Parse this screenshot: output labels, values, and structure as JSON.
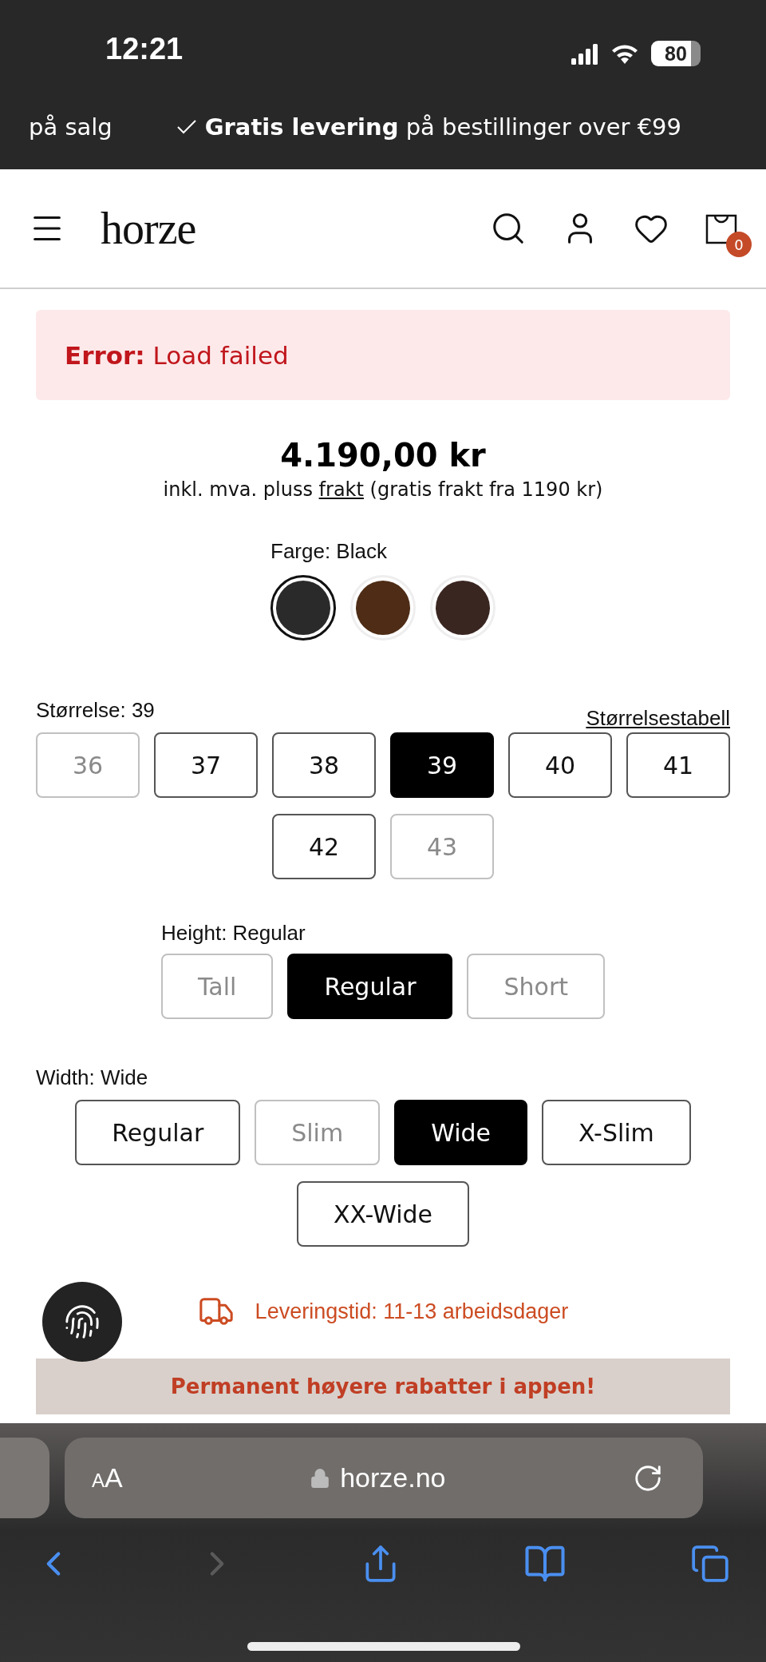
{
  "status_bar": {
    "time": "12:21",
    "battery": "80"
  },
  "promo_bar": {
    "left": "på salg",
    "bold": "Gratis levering",
    "rest": "på bestillinger over €99"
  },
  "header": {
    "logo": "horze",
    "cart_count": "0"
  },
  "error": {
    "label": "Error:",
    "message": "Load failed"
  },
  "price": {
    "amount": "4.190,00 kr",
    "note_before": "inkl. mva. pluss",
    "note_link": "frakt",
    "note_after": "(gratis frakt fra 1190 kr)"
  },
  "colors": {
    "label": "Farge: Black",
    "swatches": [
      {
        "color": "#2a2a2a",
        "selected": true
      },
      {
        "color": "#4e2c15",
        "selected": false
      },
      {
        "color": "#3a2621",
        "selected": false
      }
    ]
  },
  "sizes": {
    "label": "Størrelse: 39",
    "chart_link": "Størrelsestabell",
    "options": [
      {
        "label": "36",
        "selected": false,
        "disabled": true
      },
      {
        "label": "37",
        "selected": false,
        "disabled": false
      },
      {
        "label": "38",
        "selected": false,
        "disabled": false
      },
      {
        "label": "39",
        "selected": true,
        "disabled": false
      },
      {
        "label": "40",
        "selected": false,
        "disabled": false
      },
      {
        "label": "41",
        "selected": false,
        "disabled": false
      },
      {
        "label": "42",
        "selected": false,
        "disabled": false
      },
      {
        "label": "43",
        "selected": false,
        "disabled": true
      }
    ]
  },
  "height": {
    "label": "Height: Regular",
    "options": [
      {
        "label": "Tall",
        "selected": false,
        "disabled": true
      },
      {
        "label": "Regular",
        "selected": true,
        "disabled": false
      },
      {
        "label": "Short",
        "selected": false,
        "disabled": true
      }
    ]
  },
  "width": {
    "label": "Width: Wide",
    "options": [
      {
        "label": "Regular",
        "selected": false,
        "disabled": false
      },
      {
        "label": "Slim",
        "selected": false,
        "disabled": true
      },
      {
        "label": "Wide",
        "selected": true,
        "disabled": false
      },
      {
        "label": "X-Slim",
        "selected": false,
        "disabled": false
      },
      {
        "label": "XX-Wide",
        "selected": false,
        "disabled": false
      }
    ]
  },
  "delivery": {
    "text": "Leveringstid: 11-13 arbeidsdager"
  },
  "app_banner": {
    "text": "Permanent høyere rabatter i appen!"
  },
  "browser": {
    "text_size_button": "AA",
    "url": "horze.no"
  }
}
